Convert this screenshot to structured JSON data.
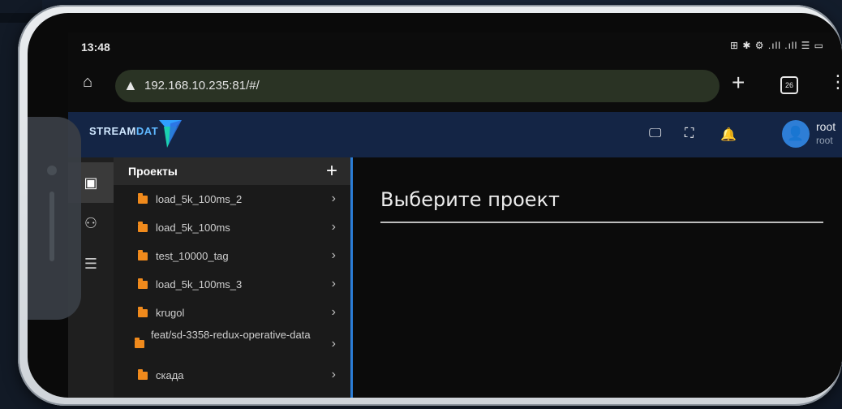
{
  "status_bar": {
    "time": "13:48",
    "icons": "⊞ ✱ ⚙ .ıll .ıll ☰ ▭"
  },
  "browser": {
    "url": "192.168.10.235:81/#/",
    "tabs_count": "26"
  },
  "app": {
    "logo_text_a": "STREAM",
    "logo_text_b": "DAT",
    "user_name": "root",
    "user_role": "root"
  },
  "projects": {
    "title": "Проекты",
    "items": [
      {
        "label": "load_5k_100ms_2"
      },
      {
        "label": "load_5k_100ms"
      },
      {
        "label": "test_10000_tag"
      },
      {
        "label": "load_5k_100ms_3"
      },
      {
        "label": "krugol"
      },
      {
        "label": "feat/sd-3358-redux-operative-data"
      },
      {
        "label": "скада"
      }
    ]
  },
  "main": {
    "title": "Выберите проект"
  },
  "colors": {
    "header_bg": "#142545",
    "accent": "#2b7dd6",
    "folder": "#f08a1c"
  }
}
